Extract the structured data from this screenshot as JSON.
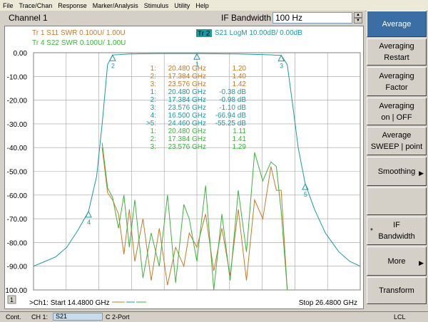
{
  "menu": [
    "File",
    "Trace/Chan",
    "Response",
    "Marker/Analysis",
    "Stimulus",
    "Utility",
    "Help"
  ],
  "channel_title": "Channel 1",
  "if_bandwidth": {
    "label": "IF Bandwidth",
    "value": "100 Hz"
  },
  "traces": [
    {
      "id": "tr1",
      "label": "Tr  1  S11 SWR 0.100U/  1.00U",
      "color": "#c87828"
    },
    {
      "id": "tr2",
      "label": "Tr  2",
      "rest": "S21 LogM 10.00dB/  0.00dB",
      "color": "#1a9aa0"
    },
    {
      "id": "tr4",
      "label": "Tr  4  S22 SWR 0.100U/  1.00U",
      "color": "#3cb43c"
    }
  ],
  "y_axis": [
    "0.00",
    "-10.00",
    "-20.00",
    "-30.00",
    "-40.00",
    "-50.00",
    "-60.00",
    "-70.00",
    "-80.00",
    "-90.00",
    "-100.00"
  ],
  "marker_table": [
    {
      "n": "1:",
      "freq": "20.480 GHz",
      "val": "1.20",
      "color": "#c87828"
    },
    {
      "n": "2:",
      "freq": "17.384 GHz",
      "val": "1.40",
      "color": "#c87828"
    },
    {
      "n": "3:",
      "freq": "23.576 GHz",
      "val": "1.42",
      "color": "#c87828"
    },
    {
      "n": "1:",
      "freq": "20.480 GHz",
      "val": "-0.38 dB",
      "color": "#1a9aa0"
    },
    {
      "n": "2:",
      "freq": "17.384 GHz",
      "val": "-0.98 dB",
      "color": "#1a9aa0"
    },
    {
      "n": "3:",
      "freq": "23.576 GHz",
      "val": "-1.10 dB",
      "color": "#1a9aa0"
    },
    {
      "n": "4:",
      "freq": "16.500 GHz",
      "val": "-66.94 dB",
      "color": "#1a9aa0"
    },
    {
      "n": ">5:",
      "freq": "24.460 GHz",
      "val": "-55.25 dB",
      "color": "#1a9aa0"
    },
    {
      "n": "1:",
      "freq": "20.480 GHz",
      "val": "1.11",
      "color": "#3cb43c"
    },
    {
      "n": "2:",
      "freq": "17.384 GHz",
      "val": "1.41",
      "color": "#3cb43c"
    },
    {
      "n": "3:",
      "freq": "23.576 GHz",
      "val": "1.29",
      "color": "#3cb43c"
    }
  ],
  "chart_data": {
    "type": "line",
    "x_start_ghz": 14.48,
    "x_stop_ghz": 26.48,
    "ylim": [
      -100,
      0
    ],
    "series": [
      {
        "name": "S21 LogM",
        "color": "#1a9aa0",
        "points": [
          [
            14.48,
            -90
          ],
          [
            14.9,
            -88
          ],
          [
            15.3,
            -86
          ],
          [
            15.7,
            -82
          ],
          [
            16.1,
            -75
          ],
          [
            16.5,
            -66.94
          ],
          [
            16.8,
            -52
          ],
          [
            17.0,
            -30
          ],
          [
            17.2,
            -5
          ],
          [
            17.384,
            -0.98
          ],
          [
            18.0,
            -0.5
          ],
          [
            19.0,
            -0.4
          ],
          [
            20.48,
            -0.38
          ],
          [
            22.0,
            -0.5
          ],
          [
            23.0,
            -0.8
          ],
          [
            23.576,
            -1.1
          ],
          [
            23.8,
            -5
          ],
          [
            24.0,
            -22
          ],
          [
            24.2,
            -40
          ],
          [
            24.46,
            -55.25
          ],
          [
            24.8,
            -66
          ],
          [
            25.2,
            -76
          ],
          [
            25.7,
            -84
          ],
          [
            26.1,
            -88
          ],
          [
            26.48,
            -90
          ]
        ]
      },
      {
        "name": "S11 SWR",
        "color": "#c87828",
        "points": [
          [
            17.0,
            -40
          ],
          [
            17.2,
            -59
          ],
          [
            17.384,
            -62
          ],
          [
            17.6,
            -68
          ],
          [
            17.8,
            -85
          ],
          [
            18.0,
            -66
          ],
          [
            18.2,
            -88
          ],
          [
            18.5,
            -70
          ],
          [
            18.8,
            -96
          ],
          [
            19.1,
            -74
          ],
          [
            19.4,
            -98
          ],
          [
            19.7,
            -82
          ],
          [
            20.0,
            -90
          ],
          [
            20.2,
            -76
          ],
          [
            20.48,
            -82
          ],
          [
            20.8,
            -68
          ],
          [
            21.1,
            -92
          ],
          [
            21.4,
            -74
          ],
          [
            21.7,
            -94
          ],
          [
            22.0,
            -66
          ],
          [
            22.3,
            -96
          ],
          [
            22.6,
            -62
          ],
          [
            22.9,
            -70
          ],
          [
            23.2,
            -48
          ],
          [
            23.4,
            -58
          ],
          [
            23.576,
            -58
          ],
          [
            23.8,
            -100
          ]
        ]
      },
      {
        "name": "S22 SWR",
        "color": "#3cb43c",
        "points": [
          [
            17.0,
            -38
          ],
          [
            17.2,
            -57
          ],
          [
            17.384,
            -61
          ],
          [
            17.6,
            -74
          ],
          [
            17.8,
            -60
          ],
          [
            18.0,
            -82
          ],
          [
            18.2,
            -62
          ],
          [
            18.5,
            -95
          ],
          [
            18.8,
            -76
          ],
          [
            19.1,
            -90
          ],
          [
            19.4,
            -60
          ],
          [
            19.7,
            -97
          ],
          [
            20.0,
            -64
          ],
          [
            20.2,
            -70
          ],
          [
            20.48,
            -88
          ],
          [
            20.8,
            -56
          ],
          [
            21.1,
            -100
          ],
          [
            21.4,
            -68
          ],
          [
            21.7,
            -96
          ],
          [
            22.0,
            -58
          ],
          [
            22.3,
            -84
          ],
          [
            22.6,
            -42
          ],
          [
            22.9,
            -54
          ],
          [
            23.2,
            -46
          ],
          [
            23.4,
            -48
          ],
          [
            23.576,
            -67
          ],
          [
            23.8,
            -100
          ]
        ]
      }
    ]
  },
  "x_axis": {
    "start": ">Ch1: Start  14.4800 GHz",
    "stop": "Stop  26.4800 GHz",
    "channel_num": "1"
  },
  "softkeys": [
    {
      "label1": "Average",
      "label2": "",
      "active": true,
      "arrow": false,
      "star": false
    },
    {
      "label1": "Averaging",
      "label2": "Restart",
      "active": false,
      "arrow": false,
      "star": false
    },
    {
      "label1": "Averaging",
      "label2": "Factor",
      "active": false,
      "arrow": false,
      "star": false
    },
    {
      "label1": "Averaging",
      "label2": "on | OFF",
      "active": false,
      "arrow": false,
      "star": false
    },
    {
      "label1": "Average",
      "label2": "SWEEP | point",
      "active": false,
      "arrow": false,
      "star": false
    },
    {
      "label1": "Smoothing",
      "label2": "",
      "active": false,
      "arrow": true,
      "star": false
    },
    {
      "label1": "",
      "label2": "",
      "active": false,
      "arrow": false,
      "star": false
    },
    {
      "label1": "IF",
      "label2": "Bandwidth",
      "active": false,
      "arrow": false,
      "star": true
    },
    {
      "label1": "More",
      "label2": "",
      "active": false,
      "arrow": true,
      "star": false
    },
    {
      "label1": "Transform",
      "label2": "",
      "active": false,
      "arrow": false,
      "star": false
    }
  ],
  "status": {
    "left": "Cont.",
    "ch": "CH 1:",
    "param": "S21",
    "port": "C  2-Port",
    "right": "LCL"
  }
}
